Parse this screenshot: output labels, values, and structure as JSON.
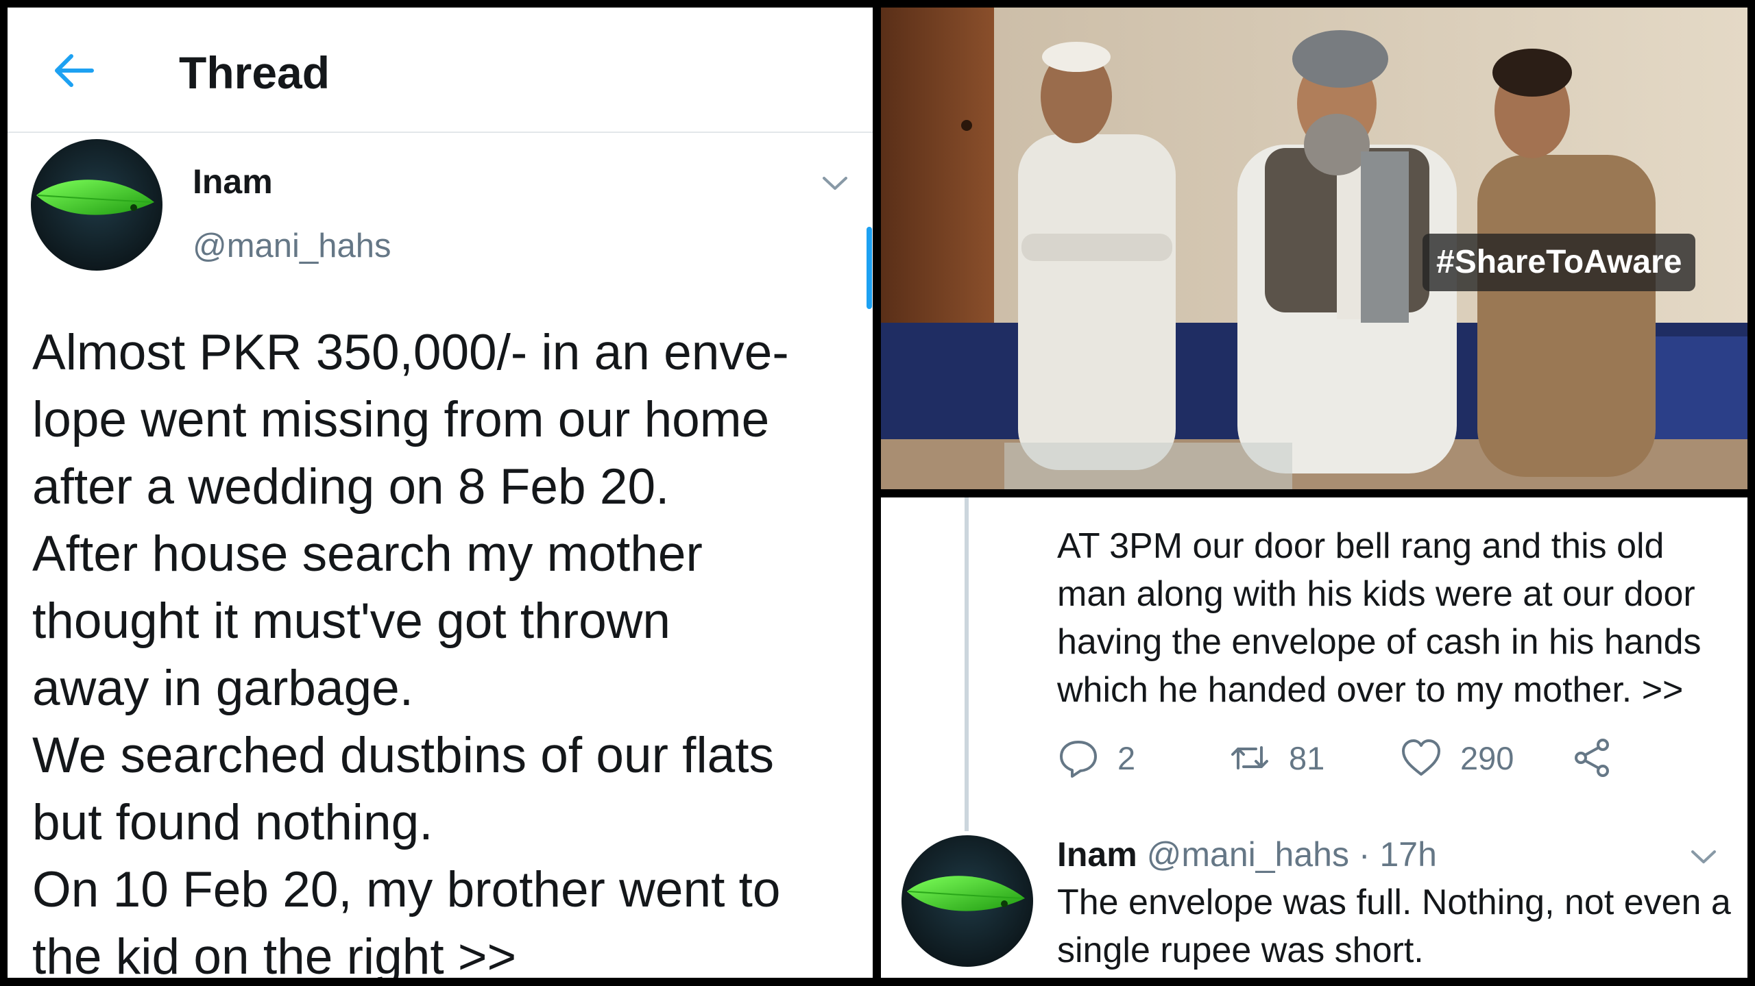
{
  "header": {
    "title": "Thread",
    "back_icon": "arrow-left-icon"
  },
  "colors": {
    "accent": "#1da1f2",
    "secondary_text": "#657786",
    "divider": "#e3e7ea",
    "thread_line": "#ccd6dd"
  },
  "main_tweet": {
    "name": "Inam",
    "handle": "@mani_hahs",
    "lines": [
      "Almost PKR 350,000/- in an enve-",
      "lope went missing from our home",
      "after a wedding on 8 Feb 20.",
      "After house search my mother",
      "thought it must've got thrown",
      "away in garbage.",
      "We searched dustbins of our flats",
      "but found nothing.",
      "On 10 Feb 20, my brother went to",
      "the kid on the right >>"
    ]
  },
  "photo": {
    "hashtag": "#ShareToAware"
  },
  "reply_tweet": {
    "text": "AT 3PM our door bell rang and this old man along with his kids were at our door having the envelope of cash in his hands which he handed over to my mother. >>",
    "actions": {
      "reply_count": "2",
      "retweet_count": "81",
      "like_count": "290"
    }
  },
  "second_reply": {
    "name": "Inam",
    "handle": "@mani_hahs",
    "separator": "·",
    "time": "17h",
    "text": "The envelope was full. Nothing, not even a single rupee was short."
  }
}
